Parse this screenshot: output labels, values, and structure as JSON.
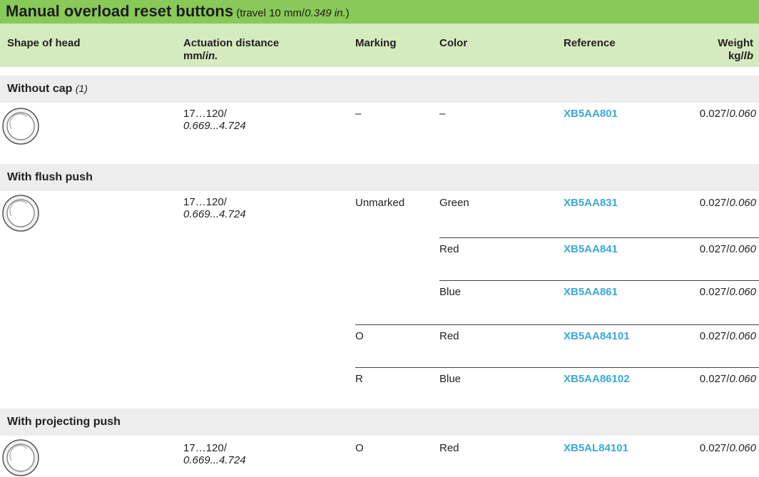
{
  "title": {
    "main": "Manual overload reset buttons",
    "sub_a": " (travel 10 mm/",
    "sub_b": "0.349 in.",
    "sub_c": ")"
  },
  "headers": {
    "shape": "Shape of head",
    "actuation_1": "Actuation distance",
    "actuation_2a": "mm/",
    "actuation_2b": "in.",
    "marking": "Marking",
    "color": "Color",
    "reference": "Reference",
    "weight_1": "Weight",
    "weight_2a": "kg/",
    "weight_2b": "lb"
  },
  "sections": [
    {
      "title": "Without cap",
      "note": "(1)",
      "distance_a": "17…120/",
      "distance_b": "0.669...4.724",
      "rows": [
        {
          "marking": "–",
          "color": "–",
          "reference": "XB5AA801",
          "weight_a": "0.027/",
          "weight_b": "0.060"
        }
      ]
    },
    {
      "title": "With flush push",
      "note": "",
      "distance_a": "17…120/",
      "distance_b": "0.669...4.724",
      "rows": [
        {
          "marking": "Unmarked",
          "color": "Green",
          "reference": "XB5AA831",
          "weight_a": "0.027/",
          "weight_b": "0.060"
        },
        {
          "marking": "",
          "color": "Red",
          "reference": "XB5AA841",
          "weight_a": "0.027/",
          "weight_b": "0.060"
        },
        {
          "marking": "",
          "color": "Blue",
          "reference": "XB5AA861",
          "weight_a": "0.027/",
          "weight_b": "0.060"
        },
        {
          "marking": "O",
          "color": "Red",
          "reference": "XB5AA84101",
          "weight_a": "0.027/",
          "weight_b": "0.060"
        },
        {
          "marking": "R",
          "color": "Blue",
          "reference": "XB5AA86102",
          "weight_a": "0.027/",
          "weight_b": "0.060"
        }
      ]
    },
    {
      "title": "With projecting push",
      "note": "",
      "distance_a": "17…120/",
      "distance_b": "0.669...4.724",
      "rows": [
        {
          "marking": "O",
          "color": "Red",
          "reference": "XB5AL84101",
          "weight_a": "0.027/",
          "weight_b": "0.060"
        }
      ]
    }
  ],
  "colors": {
    "title_bar": "#88c957",
    "header_row": "#d4ebc0",
    "section_row": "#ededed",
    "reference_text": "#3aa9d8"
  }
}
